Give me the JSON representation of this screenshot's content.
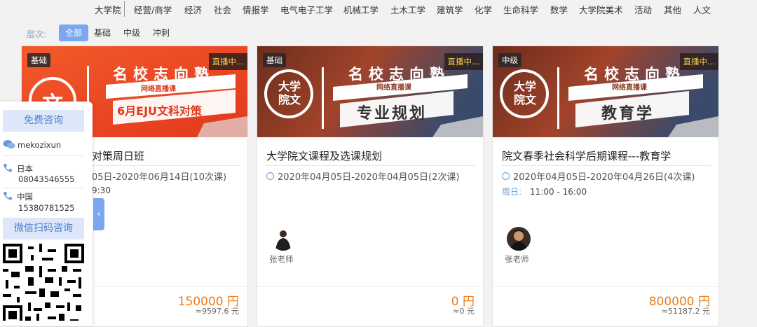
{
  "categories": [
    "大学院",
    "经营/商学",
    "经济",
    "社会",
    "情报学",
    "电气电子工学",
    "机械工学",
    "土木工学",
    "建筑学",
    "化学",
    "生命科学",
    "数学",
    "大学院美术",
    "活动",
    "其他",
    "人文"
  ],
  "levels": {
    "label": "层次:",
    "items": [
      "全部",
      "基础",
      "中级",
      "冲刺"
    ],
    "active": "全部"
  },
  "banner_common": {
    "brand": "名校志向塾",
    "subtitle": "网络直播课",
    "live": "直播中..."
  },
  "courses": [
    {
      "level_tag": "基础",
      "banner_badge": "文",
      "banner_text": "6月EJU文科对策",
      "title": "对策周日班",
      "dates": "05日-2020年06月14日(10次课)",
      "schedule": "9:30",
      "teacher": "",
      "price": "150000 円",
      "price_sub": "≈9597.6 元"
    },
    {
      "level_tag": "基础",
      "banner_badge": "大学院文",
      "banner_text": "专业规划",
      "title": "大学院文课程及选课规划",
      "dates": "2020年04月05日-2020年04月05日(2次课)",
      "schedule": "",
      "teacher": "张老师",
      "price": "0 円",
      "price_sub": "≈0 元"
    },
    {
      "level_tag": "中级",
      "banner_badge": "大学院文",
      "banner_text": "教育学",
      "title": "院文春季社会科学后期课程---教育学",
      "dates": "2020年04月05日-2020年04月26日(4次课)",
      "schedule_key": "周日:",
      "schedule": "11:00 - 16:00",
      "teacher": "张老师",
      "price": "800000 円",
      "price_sub": "≈51187.2 元"
    }
  ],
  "float_panel": {
    "consult_title": "免费咨询",
    "wechat": "mekozixun",
    "japan_label": "日本",
    "japan_phone": "08043546555",
    "china_label": "中国",
    "china_phone": "15380781525",
    "qr_title": "微信扫码咨询",
    "collapse": "‹"
  }
}
